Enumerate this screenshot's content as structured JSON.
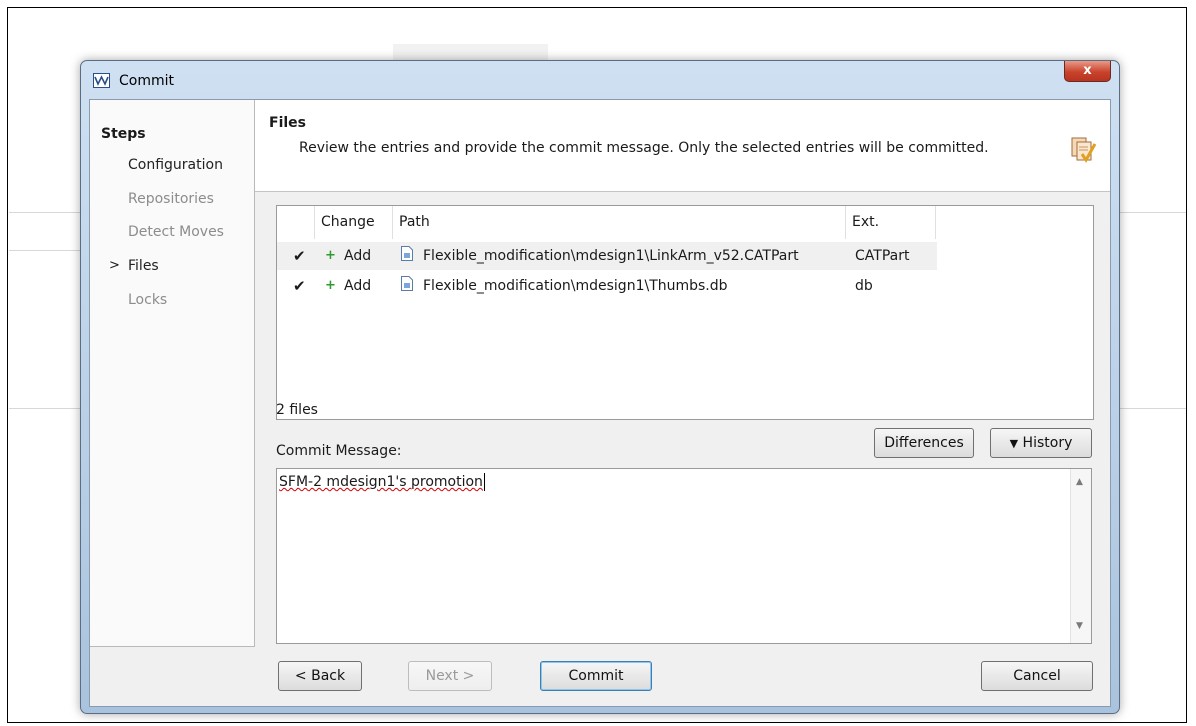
{
  "window": {
    "title": "Commit",
    "close_label": "x"
  },
  "steps": {
    "heading": "Steps",
    "items": [
      {
        "label": "Configuration",
        "state": "active"
      },
      {
        "label": "Repositories",
        "state": "disabled"
      },
      {
        "label": "Detect Moves",
        "state": "disabled"
      },
      {
        "label": "Files",
        "state": "current"
      },
      {
        "label": "Locks",
        "state": "disabled"
      }
    ],
    "current_marker": ">"
  },
  "header": {
    "title": "Files",
    "description": "Review the entries and provide the commit message. Only the selected entries will be committed.",
    "icon": "commit-files-icon"
  },
  "table": {
    "columns": [
      "Change",
      "Path",
      "Ext."
    ],
    "rows": [
      {
        "checked": true,
        "check": "✔",
        "change": "Add",
        "path": "Flexible_modification\\mdesign1\\LinkArm_v52.CATPart",
        "ext": "CATPart",
        "selected": true
      },
      {
        "checked": true,
        "check": "✔",
        "change": "Add",
        "path": "Flexible_modification\\mdesign1\\Thumbs.db",
        "ext": "db",
        "selected": false
      }
    ]
  },
  "file_count": "2 files",
  "commit": {
    "label": "Commit Message:",
    "message": "SFM-2 mdesign1's promotion",
    "differences_button": "Differences",
    "history_button": "History"
  },
  "buttons": {
    "back": "< Back",
    "next": "Next >",
    "commit": "Commit",
    "cancel": "Cancel"
  },
  "colors": {
    "titlebar": "#b8cfe6",
    "close": "#c9432c",
    "add_icon": "#2e9b2e"
  }
}
